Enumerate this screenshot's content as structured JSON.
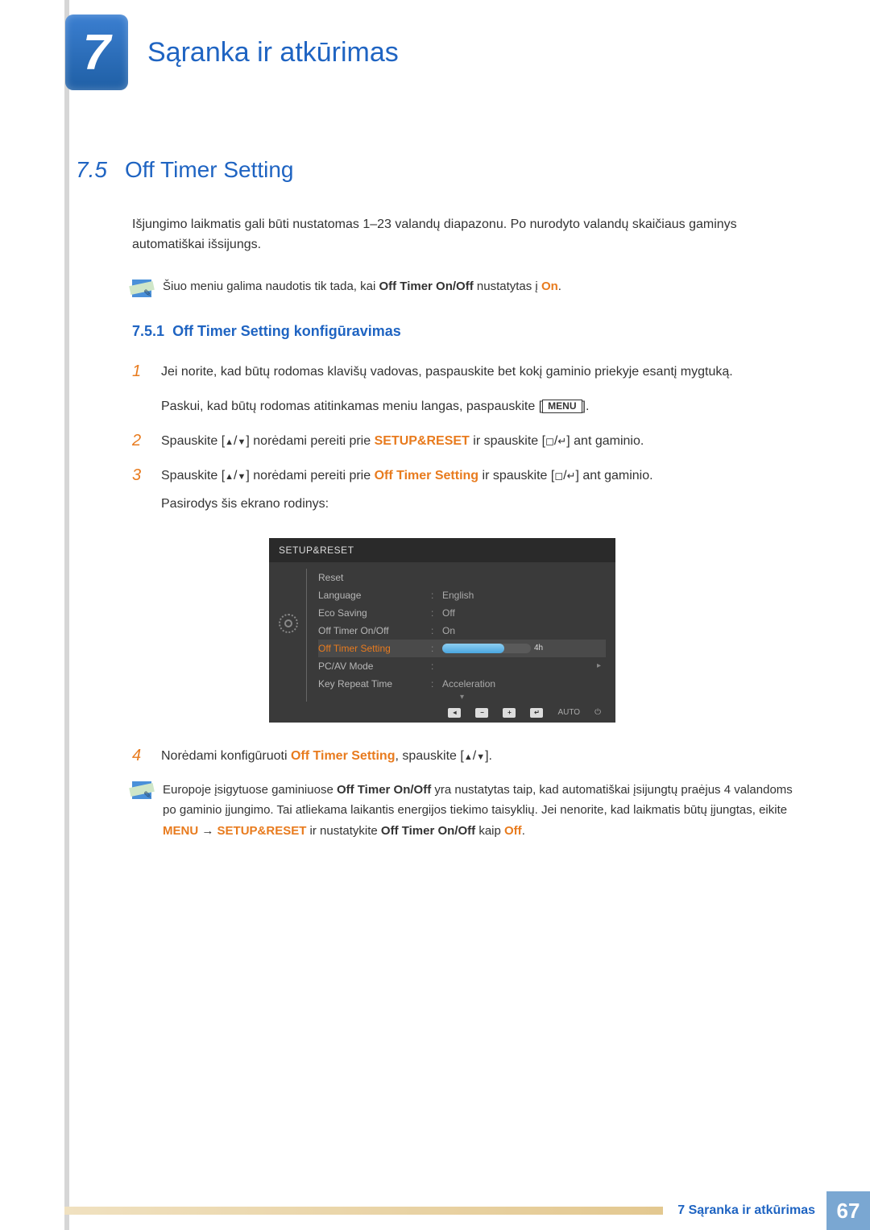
{
  "chapter": {
    "number": "7",
    "title": "Sąranka ir atkūrimas"
  },
  "section": {
    "number": "7.5",
    "title": "Off Timer Setting"
  },
  "intro": "Išjungimo laikmatis gali būti nustatomas 1–23 valandų diapazonu. Po nurodyto valandų skaičiaus gaminys automatiškai išsijungs.",
  "note1": {
    "pre": "Šiuo meniu galima naudotis tik tada, kai ",
    "bold1": "Off Timer On/Off",
    "mid": " nustatytas į ",
    "bold2": "On",
    "post": "."
  },
  "subsection": {
    "number": "7.5.1",
    "title": "Off Timer Setting konfigūravimas"
  },
  "steps": {
    "s1": {
      "text": "Jei norite, kad būtų rodomas klavišų vadovas, paspauskite bet kokį gaminio priekyje esantį mygtuką.",
      "sub_pre": "Paskui, kad būtų rodomas atitinkamas meniu langas, paspauskite [",
      "btn": "MENU",
      "sub_post": "]."
    },
    "s2": {
      "pre": "Spauskite [",
      "mid1": "] norėdami pereiti prie ",
      "hl": "SETUP&RESET",
      "mid2": " ir spauskite [",
      "post": "] ant gaminio."
    },
    "s3": {
      "pre": "Spauskite [",
      "mid1": "] norėdami pereiti prie ",
      "hl": "Off Timer Setting",
      "mid2": " ir spauskite [",
      "post": "] ant gaminio.",
      "sub": "Pasirodys šis ekrano rodinys:"
    },
    "s4": {
      "pre": "Norėdami konfigūruoti ",
      "hl": "Off Timer Setting",
      "mid": ", spauskite [",
      "post": "]."
    }
  },
  "osd": {
    "title": "SETUP&RESET",
    "rows": [
      {
        "label": "Reset",
        "val": ""
      },
      {
        "label": "Language",
        "val": "English"
      },
      {
        "label": "Eco Saving",
        "val": "Off"
      },
      {
        "label": "Off Timer On/Off",
        "val": "On"
      },
      {
        "label": "Off Timer Setting",
        "val": "4h",
        "selected": true,
        "slider": true
      },
      {
        "label": "PC/AV Mode",
        "val": ""
      },
      {
        "label": "Key Repeat Time",
        "val": "Acceleration"
      }
    ],
    "footer_auto": "AUTO"
  },
  "note2": {
    "t1": "Europoje įsigytuose gaminiuose ",
    "h1": "Off Timer On/Off",
    "t2": " yra nustatytas taip, kad automatiškai įsijungtų praėjus 4 valandoms po gaminio įjungimo. Tai atliekama laikantis energijos tiekimo taisyklių. Jei nenorite, kad laikmatis būtų įjungtas, eikite ",
    "h2": "MENU",
    "arrow": " → ",
    "h3": "SETUP&RESET",
    "t3": " ir nustatykite ",
    "h4": "Off Timer On/Off",
    "t4": " kaip ",
    "h5": "Off",
    "t5": "."
  },
  "footer": {
    "text": "7 Sąranka ir atkūrimas",
    "page": "67"
  }
}
